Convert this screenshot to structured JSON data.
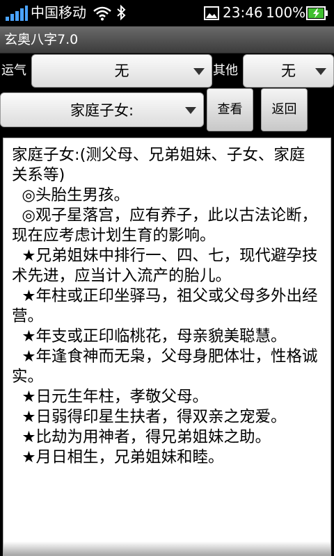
{
  "status_bar": {
    "carrier": "中国移动",
    "time": "23:46",
    "battery": "100%",
    "icons": [
      "signal-icon",
      "wifi-icon",
      "bluetooth-icon",
      "image-icon",
      "battery-charging-icon"
    ]
  },
  "app": {
    "title": "玄奥八字7.0"
  },
  "controls": {
    "luck_label": "运气",
    "luck_value": "无",
    "other_label": "其他",
    "other_value": "无",
    "category_value": "家庭子女:",
    "view_button": "查看",
    "back_button": "返回"
  },
  "content": {
    "text": "家庭子女:(测父母、兄弟姐妹、子女、家庭关系等)\n  ◎头胎生男孩。\n  ◎观子星落宫，应有养子，此以古法论断，现在应考虑计划生育的影响。\n  ★兄弟姐妹中排行一、四、七，现代避孕技术先进，应当计入流产的胎儿。\n  ★年柱或正印坐驿马，祖父或父母多外出经营。\n  ★年支或正印临桃花，母亲貌美聪慧。\n  ★年逢食神而无枭，父母身肥体壮，性格诚实。\n  ★日元生年柱，孝敬父母。\n  ★日弱得印星生扶者，得双亲之宠爱。\n  ★比劫为用神者，得兄弟姐妹之助。\n  ★月日相生，兄弟姐妹和睦。"
  },
  "colors": {
    "battery_green": "#3fbf2f",
    "title_bar": "#4f4f4f"
  }
}
